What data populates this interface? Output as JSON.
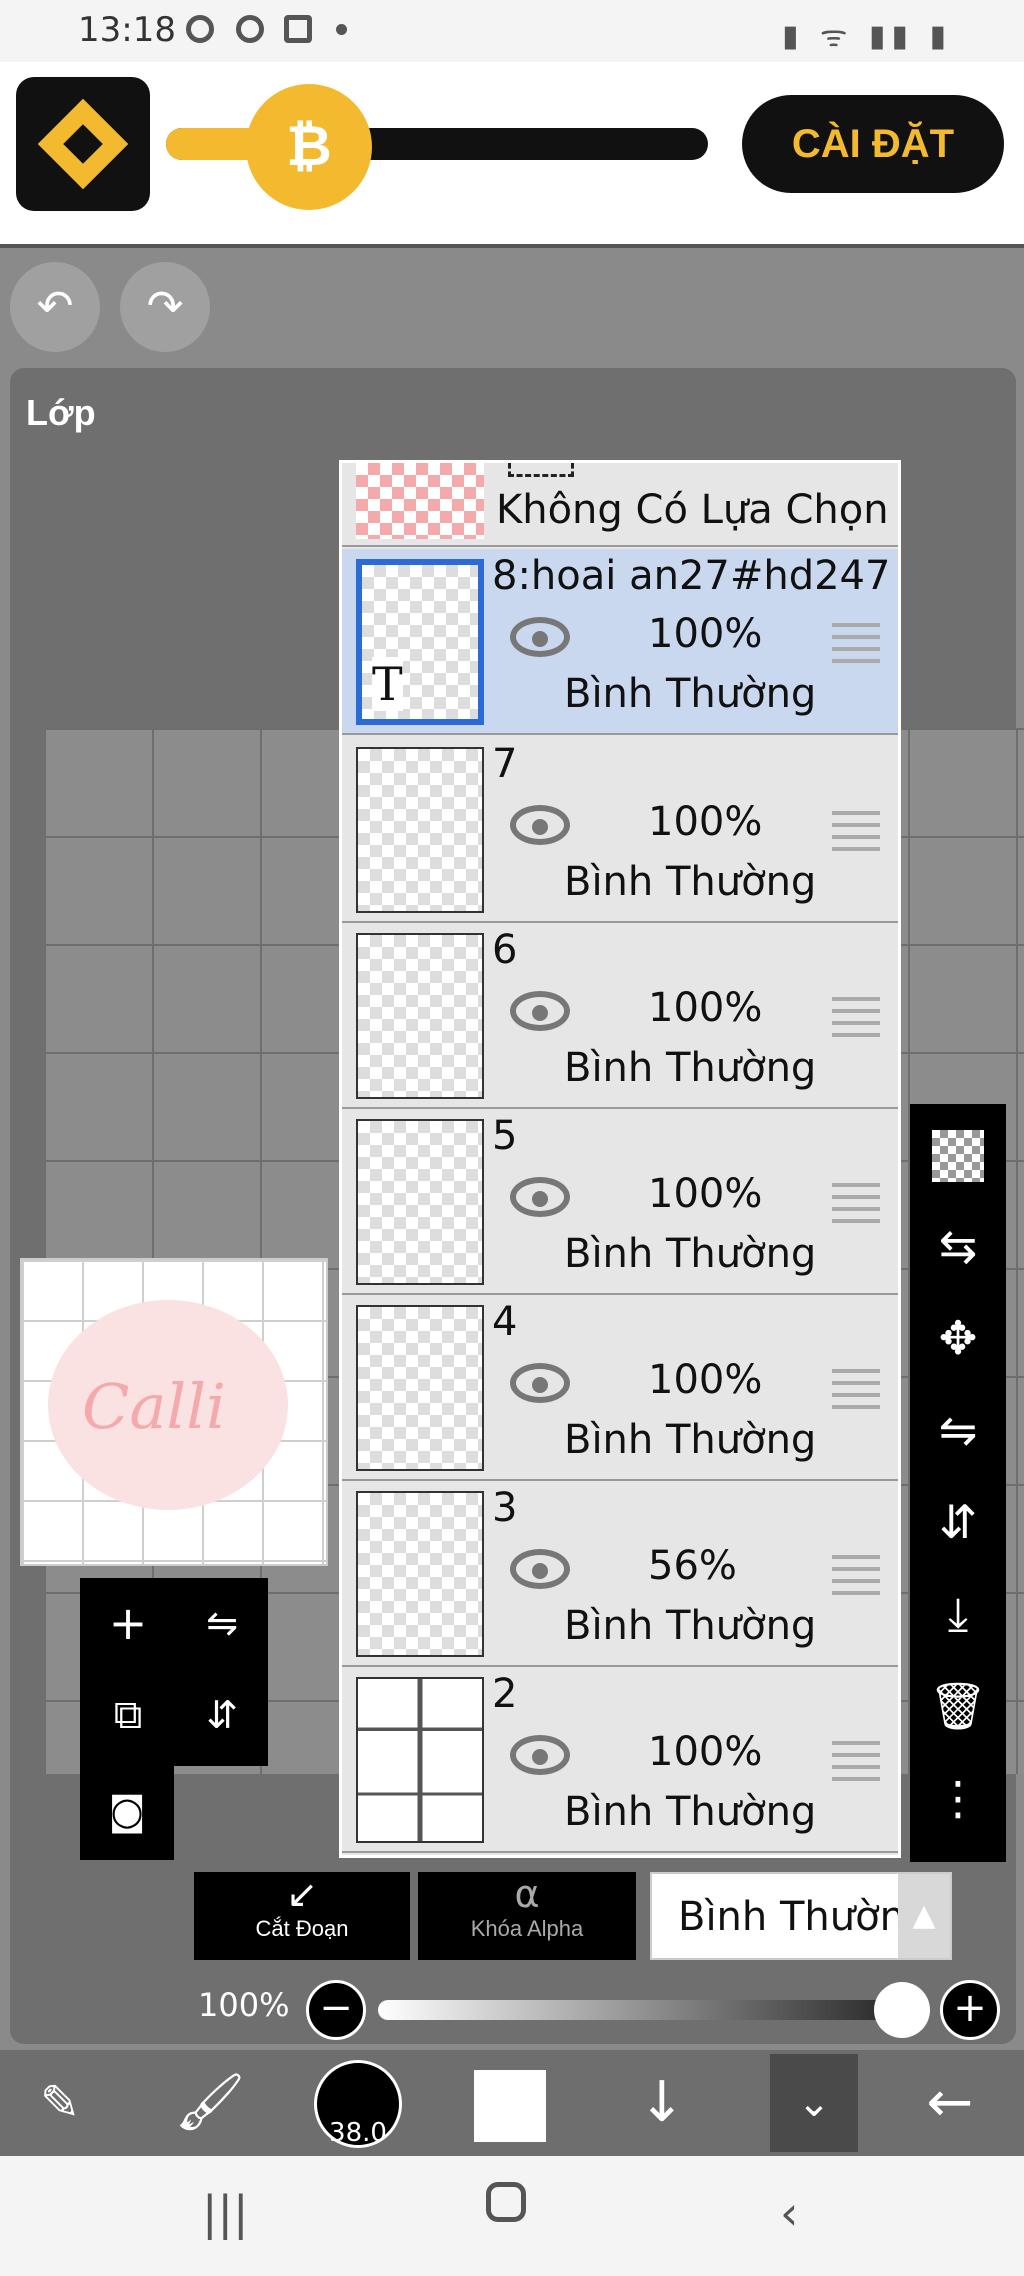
{
  "status_bar": {
    "time": "13:18",
    "right_icons": "▮ ᯤ ▮▮ ▮"
  },
  "ad": {
    "install_label": "CÀI ĐẶT",
    "coin_symbol": "₿",
    "brand_color": "#f3ba2f"
  },
  "topbar": {
    "undo_icon": "↶",
    "redo_icon": "↷"
  },
  "panel": {
    "title": "Lớp"
  },
  "preview": {
    "text": "Calli"
  },
  "layers": {
    "no_selection": "Không Có Lựa Chọn",
    "items": [
      {
        "name": "8:hoai an27#hd247",
        "opacity": "100%",
        "mode": "Bình Thường",
        "selected": true,
        "thumb_text": "T"
      },
      {
        "name": "7",
        "opacity": "100%",
        "mode": "Bình Thường"
      },
      {
        "name": "6",
        "opacity": "100%",
        "mode": "Bình Thường"
      },
      {
        "name": "5",
        "opacity": "100%",
        "mode": "Bình Thường"
      },
      {
        "name": "4",
        "opacity": "100%",
        "mode": "Bình Thường"
      },
      {
        "name": "3",
        "opacity": "56%",
        "mode": "Bình Thường"
      },
      {
        "name": "2",
        "opacity": "100%",
        "mode": "Bình Thường"
      }
    ]
  },
  "tools": {
    "clip_label": "Cắt Đoạn",
    "alpha_lock_label": "Khóa Alpha",
    "blend_mode": "Bình Thường",
    "opacity_value": "100%",
    "opacity_fraction": 1.0,
    "brush_size": "38.0"
  }
}
